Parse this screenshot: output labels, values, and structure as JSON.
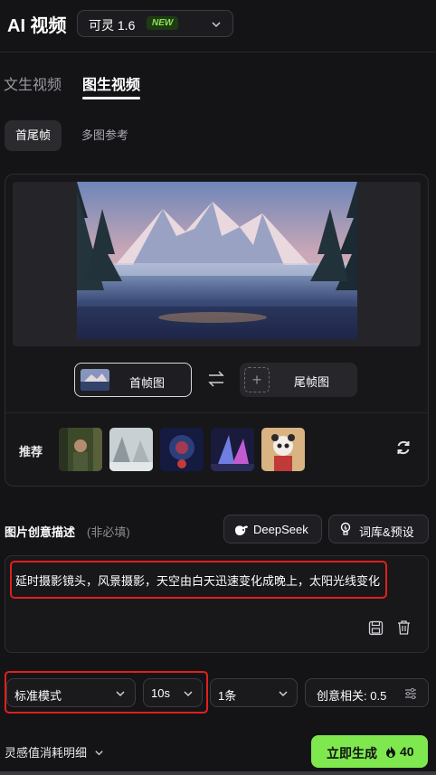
{
  "header": {
    "title": "AI 视频",
    "model": {
      "name": "可灵 1.6",
      "badge": "NEW"
    }
  },
  "tabs": [
    {
      "label": "文生视频",
      "active": false
    },
    {
      "label": "图生视频",
      "active": true
    }
  ],
  "subtabs": [
    {
      "label": "首尾帧",
      "active": true
    },
    {
      "label": "多图参考",
      "active": false
    }
  ],
  "frames": {
    "first_label": "首帧图",
    "last_label": "尾帧图"
  },
  "recommend": {
    "label": "推荐",
    "thumbnails": [
      "forest-portrait",
      "snowy-scene",
      "space-character",
      "neon-figures",
      "panda-character"
    ]
  },
  "description": {
    "label": "图片创意描述",
    "optional": "(非必填)",
    "deepseek_label": "DeepSeek",
    "library_label": "词库&预设",
    "text": "延时摄影镜头，风景摄影，天空由白天迅速变化成晚上，太阳光线变化"
  },
  "settings": {
    "mode": "标准模式",
    "duration": "10s",
    "count": "1条",
    "relevance": "创意相关: 0.5"
  },
  "footer": {
    "details_label": "灵感值消耗明细",
    "generate_label": "立即生成",
    "cost": "40"
  },
  "colors": {
    "accent_green": "#7ee84e",
    "highlight_red": "#e0201c",
    "background": "#141416"
  }
}
